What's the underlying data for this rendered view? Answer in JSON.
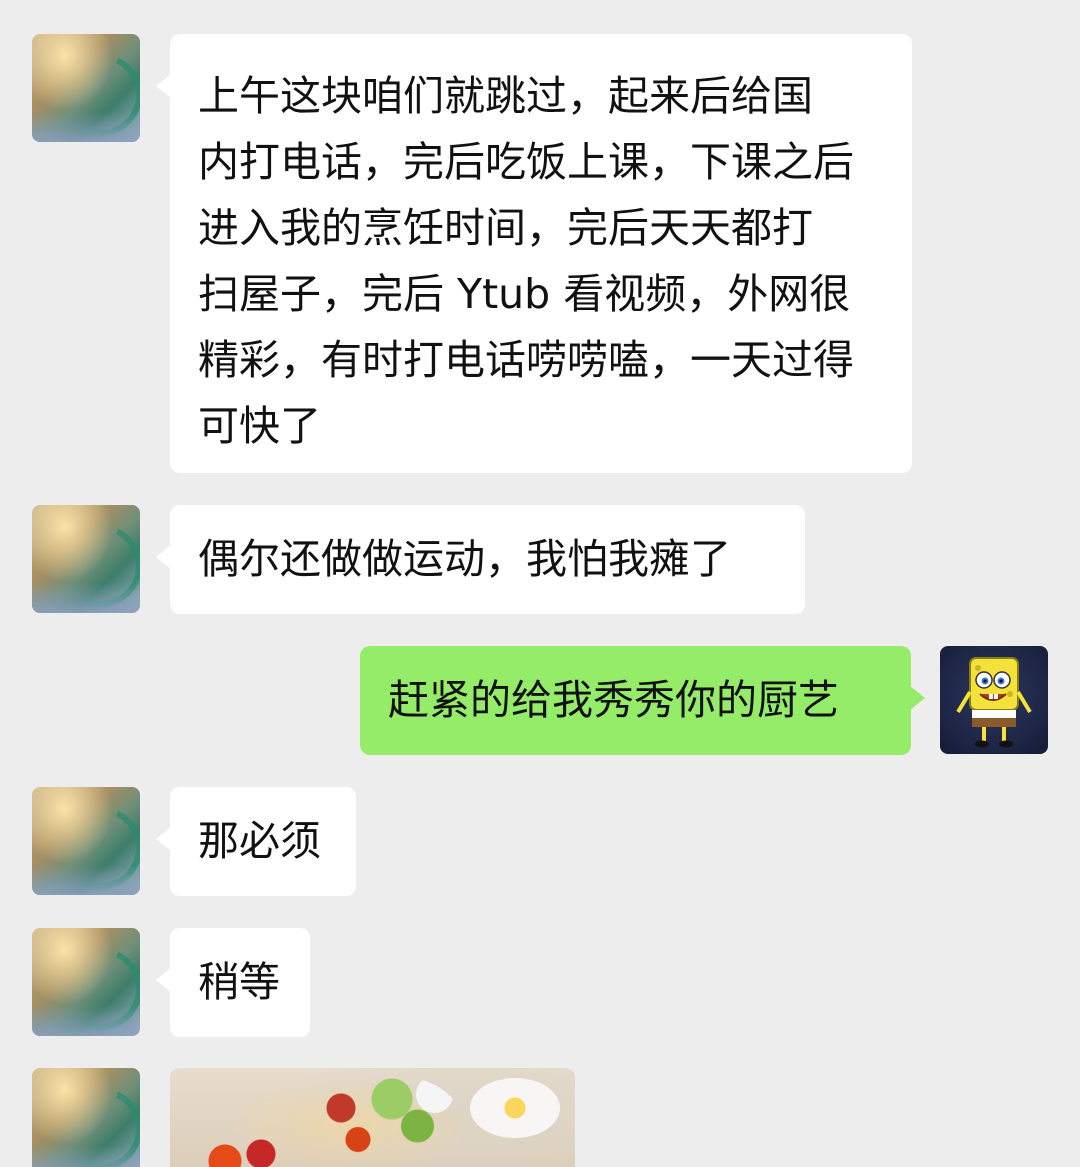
{
  "messages": [
    {
      "sender": "friend",
      "lines": [
        "上午这块咱们就跳过，起来后给国",
        "内打电话，完后吃饭上课，下课之后",
        "进入我的烹饪时间，完后天天都打",
        "扫屋子，完后 Ytub 看视频，外网很",
        "精彩，有时打电话唠唠嗑，一天过得",
        "可快了"
      ]
    },
    {
      "sender": "friend",
      "lines": [
        "偶尔还做做运动，我怕我瘫了"
      ]
    },
    {
      "sender": "self",
      "lines": [
        "赶紧的给我秀秀你的厨艺"
      ]
    },
    {
      "sender": "friend",
      "lines": [
        "那必须"
      ]
    },
    {
      "sender": "friend",
      "lines": [
        "稍等"
      ]
    },
    {
      "sender": "friend",
      "type": "image"
    }
  ],
  "colors": {
    "background": "#ededed",
    "bubble_friend": "#ffffff",
    "bubble_self": "#95ec69",
    "text": "#111111"
  },
  "icons": {
    "friend_avatar": "photo-avatar",
    "self_avatar": "cartoon-sponge-avatar"
  }
}
